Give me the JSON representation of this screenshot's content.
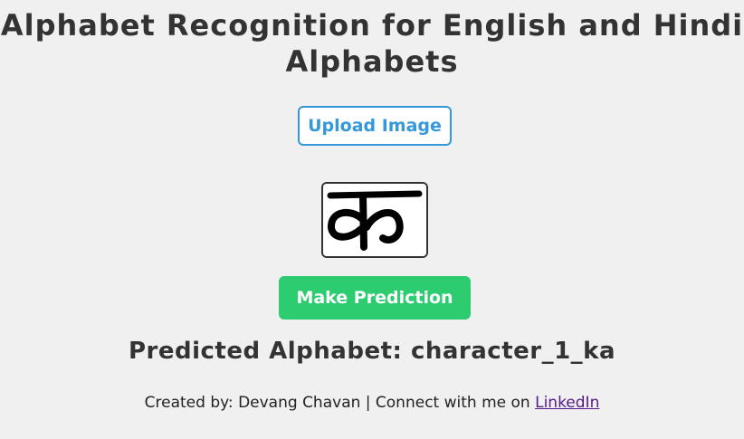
{
  "page": {
    "title": "Alphabet Recognition for English and Hindi Alphabets"
  },
  "upload": {
    "label": "Upload Image"
  },
  "preview": {
    "glyph": "क"
  },
  "predict": {
    "label": "Make Prediction"
  },
  "result": {
    "text": "Predicted Alphabet: character_1_ka"
  },
  "footer": {
    "prefix": "Created by: Devang Chavan | Connect with me on ",
    "link_text": "LinkedIn"
  },
  "colors": {
    "background": "#f0f0f0",
    "upload_accent": "#3498db",
    "predict_green": "#2ecc71",
    "text": "#333333",
    "link_visited": "#551a8b"
  }
}
